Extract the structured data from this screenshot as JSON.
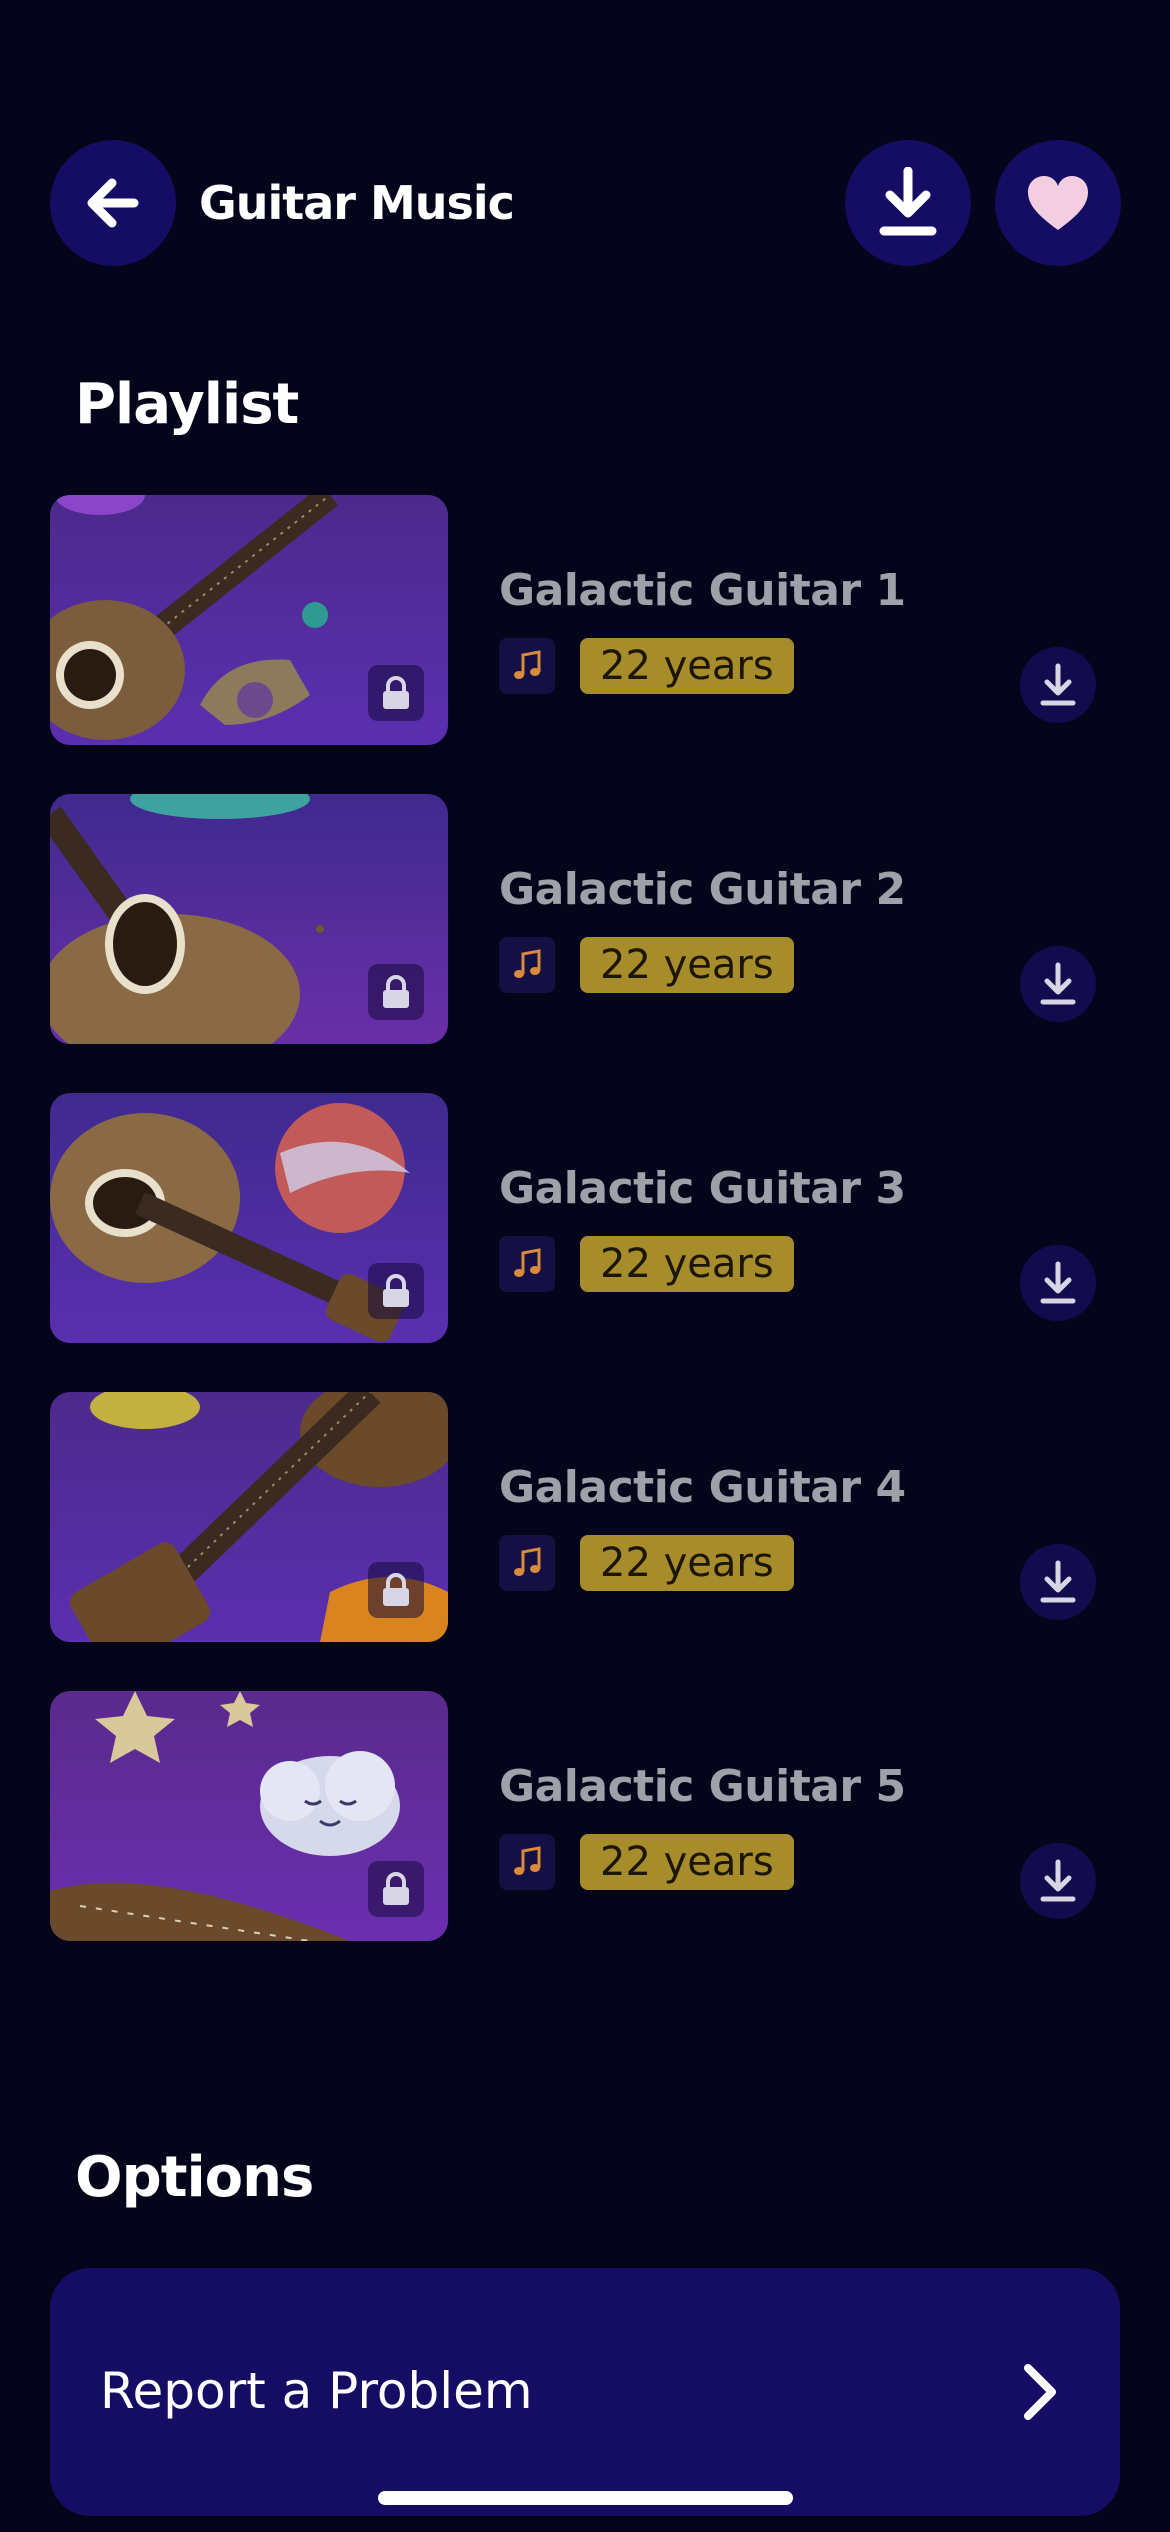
{
  "header": {
    "title": "Guitar Music",
    "back_icon": "arrow-left-icon",
    "download_icon": "download-icon",
    "favorite_icon": "heart-icon"
  },
  "playlist": {
    "title": "Playlist",
    "tracks": [
      {
        "title": "Galactic Guitar 1",
        "age": "22 years"
      },
      {
        "title": "Galactic Guitar 2",
        "age": "22 years"
      },
      {
        "title": "Galactic Guitar 3",
        "age": "22 years"
      },
      {
        "title": "Galactic Guitar 4",
        "age": "22 years"
      },
      {
        "title": "Galactic Guitar 5",
        "age": "22 years"
      }
    ]
  },
  "options": {
    "title": "Options",
    "report_label": "Report a Problem"
  },
  "colors": {
    "background": "#04041a",
    "button": "#150d63",
    "age_badge": "#a78c2b",
    "heart": "#f3cde0",
    "note": "#d98a3c"
  }
}
